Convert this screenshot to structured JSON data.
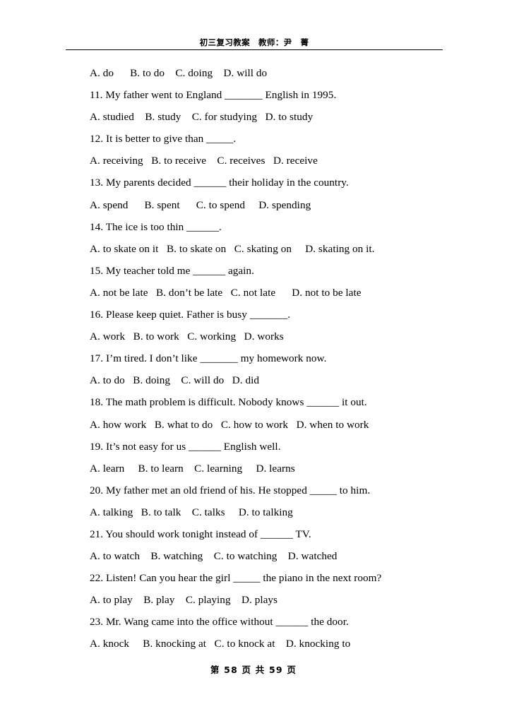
{
  "header": {
    "text": "初三复习教案　教师：尹　菁"
  },
  "footer": {
    "text": "第 58 页 共 59 页",
    "current_page": 58,
    "total_pages": 59
  },
  "body": {
    "lines": [
      {
        "type": "options",
        "text": "A. do      B. to do    C. doing    D. will do"
      },
      {
        "type": "question",
        "text": "11. My father went to England _______ English in 1995."
      },
      {
        "type": "options",
        "text": "A. studied    B. study    C. for studying   D. to study"
      },
      {
        "type": "question",
        "text": "12. It is better to give than _____."
      },
      {
        "type": "options",
        "text": "A. receiving   B. to receive    C. receives   D. receive"
      },
      {
        "type": "question",
        "text": "13. My parents decided ______ their holiday in the country."
      },
      {
        "type": "options",
        "text": "A. spend      B. spent      C. to spend     D. spending"
      },
      {
        "type": "question",
        "text": "14. The ice is too thin ______."
      },
      {
        "type": "options",
        "text": "A. to skate on it   B. to skate on   C. skating on     D. skating on it."
      },
      {
        "type": "question",
        "text": "15. My teacher told me ______ again."
      },
      {
        "type": "options",
        "text": "A. not be late   B. don’t be late   C. not late      D. not to be late"
      },
      {
        "type": "question",
        "text": "16. Please keep quiet. Father is busy _______."
      },
      {
        "type": "options",
        "text": "A. work   B. to work   C. working   D. works"
      },
      {
        "type": "question",
        "text": "17. I’m tired. I don’t like _______ my homework now."
      },
      {
        "type": "options",
        "text": "A. to do   B. doing    C. will do   D. did"
      },
      {
        "type": "question",
        "text": "18. The math problem is difficult. Nobody knows ______ it out."
      },
      {
        "type": "options",
        "text": "A. how work   B. what to do   C. how to work   D. when to work"
      },
      {
        "type": "question",
        "text": "19. It’s not easy for us ______ English well."
      },
      {
        "type": "options",
        "text": "A. learn     B. to learn    C. learning     D. learns"
      },
      {
        "type": "question",
        "text": "20. My father met an old friend of his. He stopped _____ to him."
      },
      {
        "type": "options",
        "text": "A. talking   B. to talk    C. talks     D. to talking"
      },
      {
        "type": "question",
        "text": "21. You should work tonight instead of ______ TV."
      },
      {
        "type": "options",
        "text": "A. to watch    B. watching    C. to watching    D. watched"
      },
      {
        "type": "question",
        "text": "22. Listen! Can you hear the girl _____ the piano in the next room?"
      },
      {
        "type": "options",
        "text": "A. to play    B. play    C. playing    D. plays"
      },
      {
        "type": "question",
        "text": "23. Mr. Wang came into the office without ______ the door."
      },
      {
        "type": "options",
        "text": "A. knock     B. knocking at   C. to knock at    D. knocking to"
      }
    ],
    "questions": [
      {
        "number": 11,
        "stem": "My father went to England _______ English in 1995.",
        "options": [
          "A. studied",
          "B. study",
          "C. for studying",
          "D. to study"
        ]
      },
      {
        "number": 12,
        "stem": "It is better to give than _____.",
        "options": [
          "A. receiving",
          "B. to receive",
          "C. receives",
          "D. receive"
        ]
      },
      {
        "number": 13,
        "stem": "My parents decided ______ their holiday in the country.",
        "options": [
          "A. spend",
          "B. spent",
          "C. to spend",
          "D. spending"
        ]
      },
      {
        "number": 14,
        "stem": "The ice is too thin ______.",
        "options": [
          "A. to skate on it",
          "B. to skate on",
          "C. skating on",
          "D. skating on it."
        ]
      },
      {
        "number": 15,
        "stem": "My teacher told me ______ again.",
        "options": [
          "A. not be late",
          "B. don’t be late",
          "C. not late",
          "D. not to be late"
        ]
      },
      {
        "number": 16,
        "stem": "Please keep quiet. Father is busy _______.",
        "options": [
          "A. work",
          "B. to work",
          "C. working",
          "D. works"
        ]
      },
      {
        "number": 17,
        "stem": "I’m tired. I don’t like _______ my homework now.",
        "options": [
          "A. to do",
          "B. doing",
          "C. will do",
          "D. did"
        ]
      },
      {
        "number": 18,
        "stem": "The math problem is difficult. Nobody knows ______ it out.",
        "options": [
          "A. how work",
          "B. what to do",
          "C. how to work",
          "D. when to work"
        ]
      },
      {
        "number": 19,
        "stem": "It’s not easy for us ______ English well.",
        "options": [
          "A. learn",
          "B. to learn",
          "C. learning",
          "D. learns"
        ]
      },
      {
        "number": 20,
        "stem": "My father met an old friend of his. He stopped _____ to him.",
        "options": [
          "A. talking",
          "B. to talk",
          "C. talks",
          "D. to talking"
        ]
      },
      {
        "number": 21,
        "stem": "You should work tonight instead of ______ TV.",
        "options": [
          "A. to watch",
          "B. watching",
          "C. to watching",
          "D. watched"
        ]
      },
      {
        "number": 22,
        "stem": "Listen! Can you hear the girl _____ the piano in the next room?",
        "options": [
          "A. to play",
          "B. play",
          "C. playing",
          "D. plays"
        ]
      },
      {
        "number": 23,
        "stem": "Mr. Wang came into the office without ______ the door.",
        "options": [
          "A. knock",
          "B. knocking at",
          "C. to knock at",
          "D. knocking to"
        ]
      }
    ],
    "partial_first_line_options": [
      "A. do",
      "B. to do",
      "C. doing",
      "D. will do"
    ]
  }
}
